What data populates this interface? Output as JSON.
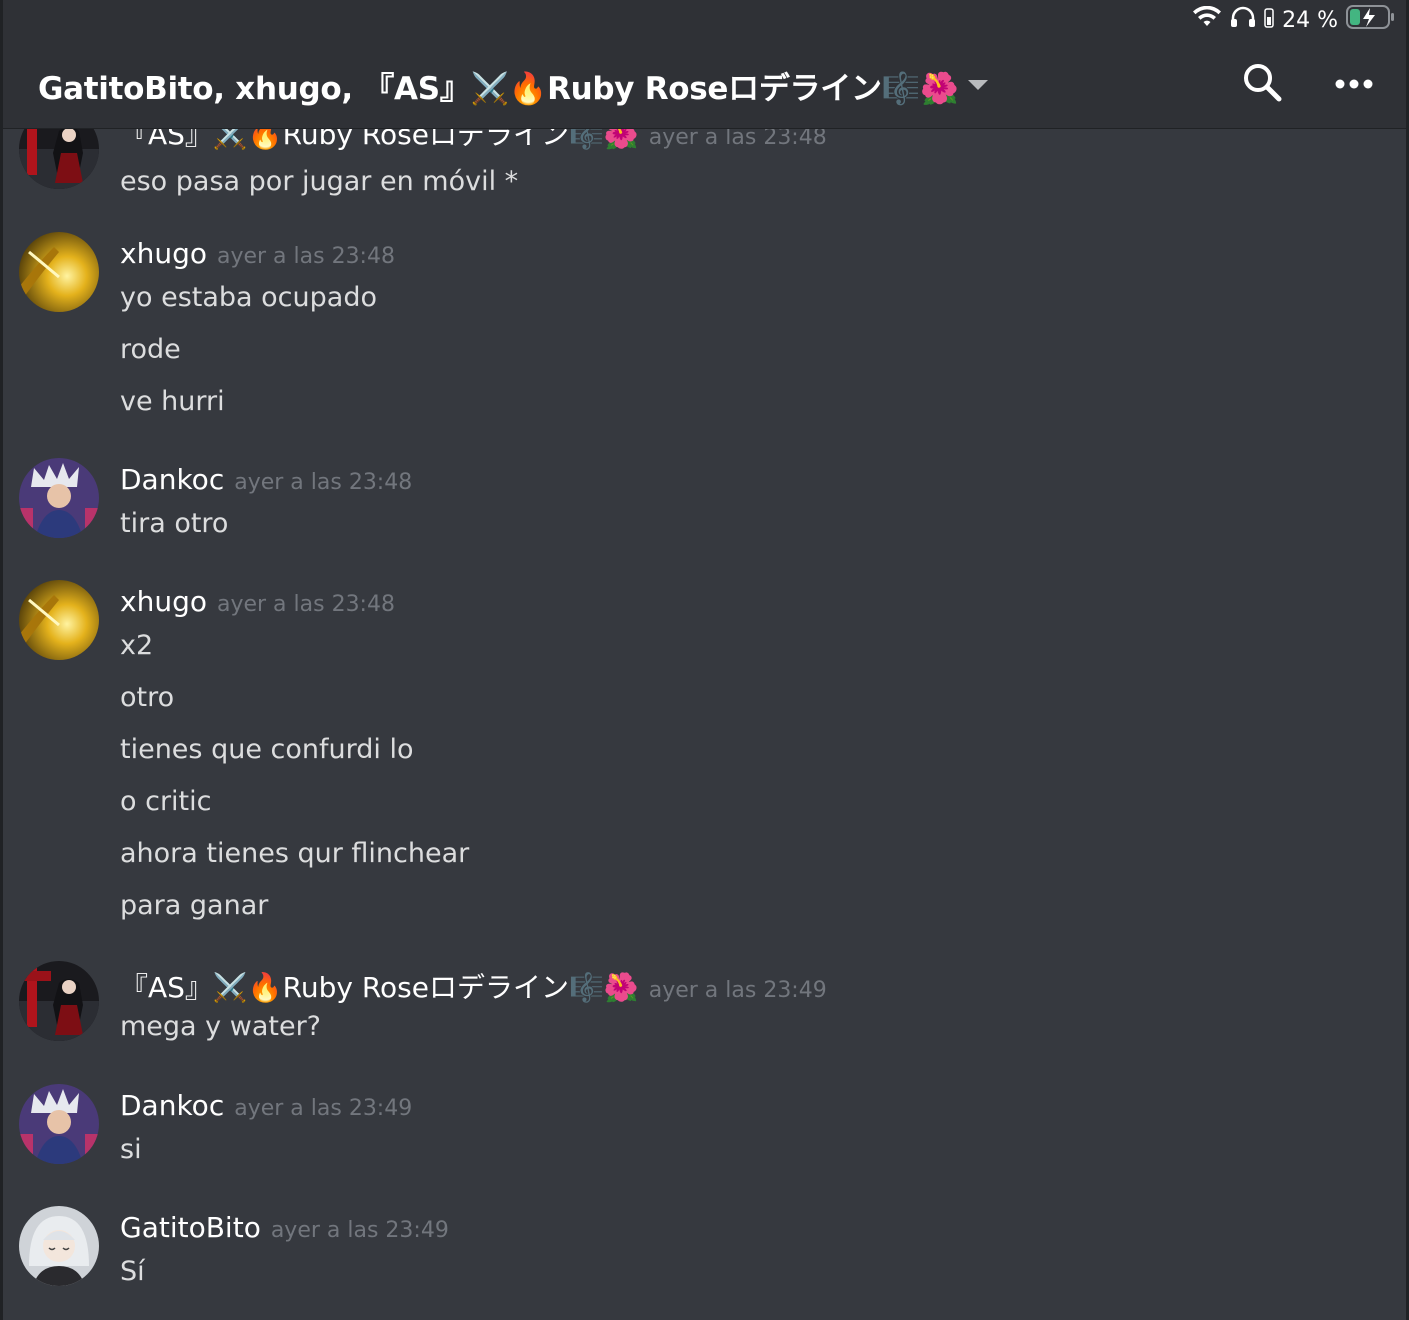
{
  "status_bar": {
    "battery_percent": "24 %",
    "wifi_icon": "wifi-icon",
    "headphones_icon": "headphones-icon",
    "battery_icon": "battery-charging-icon"
  },
  "header": {
    "title": "GatitoBito, xhugo, 『AS』⚔️🔥Ruby Roseロデライン🎼🌺",
    "search_icon": "search-icon",
    "more_icon": "more-icon"
  },
  "messages": [
    {
      "author": "『AS』⚔️🔥Ruby Roseロデライン🎼🌺",
      "timestamp": "ayer a las 23:48",
      "avatar": "ruby-avatar",
      "lines": [
        "eso pasa por jugar en móvil *"
      ],
      "cut_off_top": true
    },
    {
      "author": "xhugo",
      "timestamp": "ayer a las 23:48",
      "avatar": "xhugo-avatar",
      "lines": [
        "yo estaba ocupado",
        "rode",
        "ve hurri"
      ]
    },
    {
      "author": "Dankoc",
      "timestamp": "ayer a las 23:48",
      "avatar": "dankoc-avatar",
      "lines": [
        "tira otro"
      ]
    },
    {
      "author": "xhugo",
      "timestamp": "ayer a las 23:48",
      "avatar": "xhugo-avatar",
      "lines": [
        "x2",
        "otro",
        "tienes que confurdi lo",
        "o critic",
        "ahora tienes qur flinchear",
        "para ganar"
      ]
    },
    {
      "author": "『AS』⚔️🔥Ruby Roseロデライン🎼🌺",
      "timestamp": "ayer a las 23:49",
      "avatar": "ruby-avatar",
      "lines": [
        "mega y water?"
      ]
    },
    {
      "author": "Dankoc",
      "timestamp": "ayer a las 23:49",
      "avatar": "dankoc-avatar",
      "lines": [
        "si"
      ]
    },
    {
      "author": "GatitoBito",
      "timestamp": "ayer a las 23:49",
      "avatar": "gatitobito-avatar",
      "lines": [
        "Sí"
      ]
    }
  ]
}
